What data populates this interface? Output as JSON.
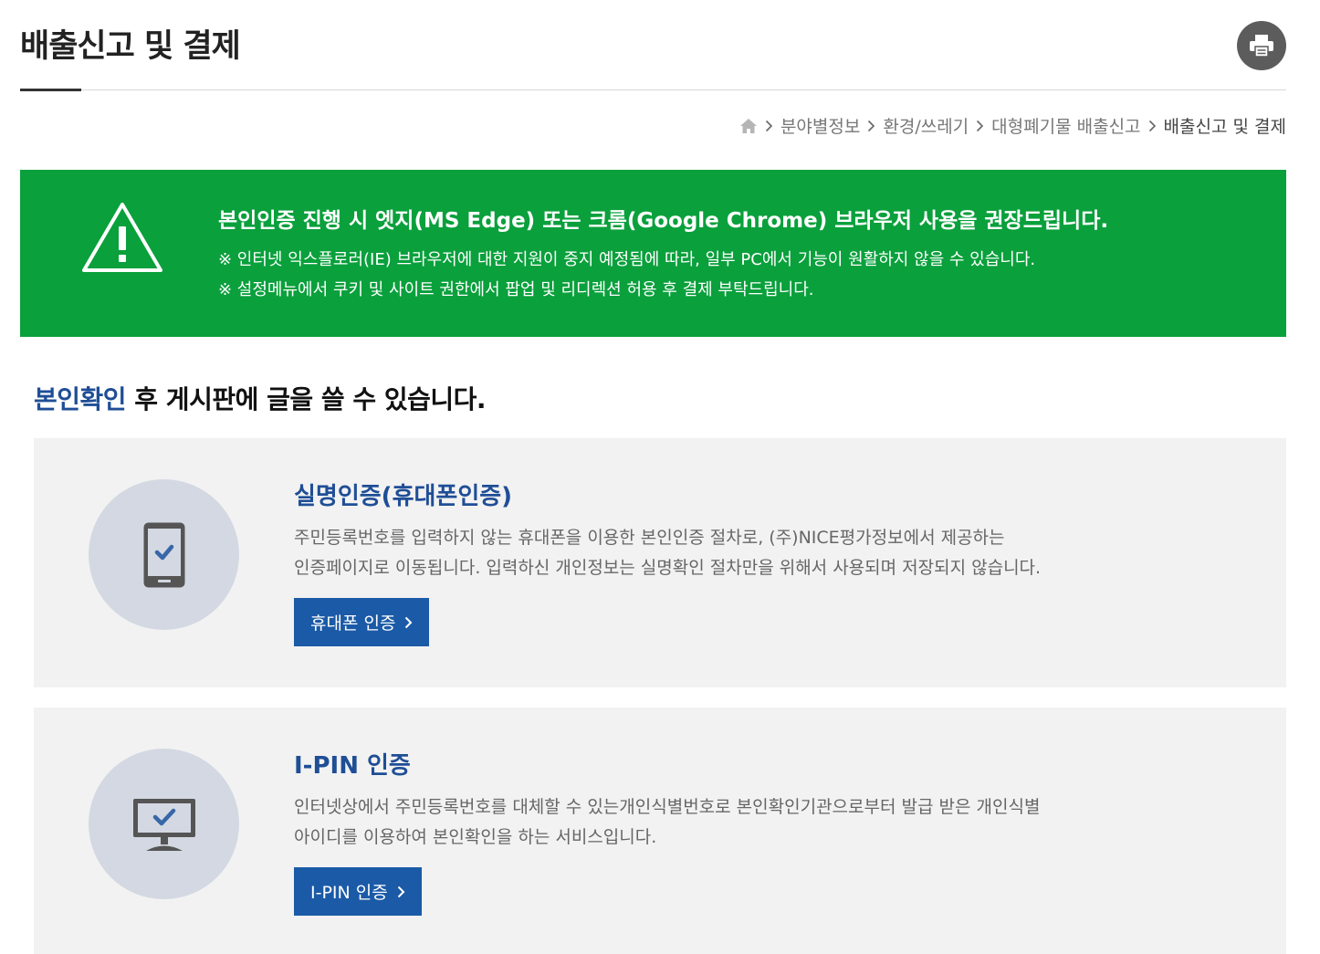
{
  "header": {
    "title": "배출신고 및 결제",
    "print_icon": "printer-icon"
  },
  "breadcrumb": {
    "home_icon": "home-icon",
    "items": [
      "분야별정보",
      "환경/쓰레기",
      "대형폐기물 배출신고",
      "배출신고 및 결제"
    ]
  },
  "notice": {
    "icon": "warning-icon",
    "background": "#0aa03c",
    "main": "본인인증 진행 시 엣지(MS Edge) 또는 크롬(Google Chrome) 브라우저 사용을 권장드립니다.",
    "line1": "※ 인터넷 익스플로러(IE) 브라우저에 대한 지원이 중지 예정됨에 따라, 일부 PC에서 기능이 원활하지 않을 수 있습니다.",
    "line2": "※ 설정메뉴에서 쿠키 및 사이트 권한에서 팝업 및 리디렉션 허용 후 결제 부탁드립니다."
  },
  "lead": {
    "highlight": "본인확인",
    "rest": " 후 게시판에 글을 쓸 수 있습니다."
  },
  "methods": [
    {
      "icon": "mobile-phone-icon",
      "title": "실명인증(휴대폰인증)",
      "desc1": "주민등록번호를 입력하지 않는 휴대폰을 이용한 본인인증 절차로, (주)NICE평가정보에서 제공하는",
      "desc2": "인증페이지로 이동됩니다. 입력하신 개인정보는 실명확인 절차만을 위해서 사용되며 저장되지 않습니다.",
      "button": "휴대폰 인증"
    },
    {
      "icon": "monitor-icon",
      "title": "I-PIN 인증",
      "desc1": "인터넷상에서 주민등록번호를 대체할 수 있는개인식별번호로 본인확인기관으로부터 발급 받은 개인식별",
      "desc2": "아이디를 이용하여 본인확인을 하는 서비스입니다.",
      "button": "I-PIN 인증"
    }
  ],
  "colors": {
    "accent_blue": "#1f4e96",
    "button_blue": "#1b5aa7",
    "card_bg": "#f2f2f2"
  }
}
